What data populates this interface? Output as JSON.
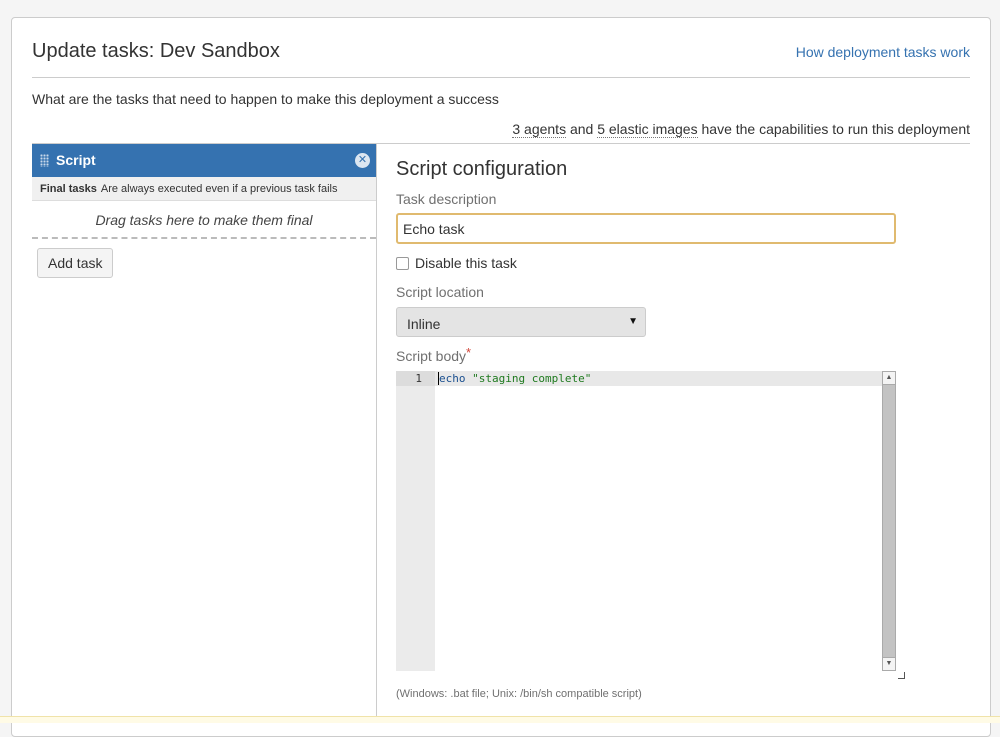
{
  "header": {
    "title": "Update tasks: Dev Sandbox",
    "help_link": "How deployment tasks work"
  },
  "intro": "What are the tasks that need to happen to make this deployment a success",
  "capabilities": {
    "agents": "3 agents",
    "conjunction": " and ",
    "images": "5 elastic images",
    "suffix": " have the capabilities to run this deployment"
  },
  "task_list": {
    "tasks": [
      {
        "name": "Script",
        "selected": true
      }
    ],
    "final_tasks": {
      "title": "Final tasks",
      "description": "Are always executed even if a previous task fails",
      "drop_hint": "Drag tasks here to make them final"
    },
    "add_task_label": "Add task"
  },
  "config": {
    "title": "Script configuration",
    "task_description_label": "Task description",
    "task_description_value": "Echo task",
    "disable_label": "Disable this task",
    "disable_checked": false,
    "script_location_label": "Script location",
    "script_location_value": "Inline",
    "script_body_label": "Script body",
    "required_marker": "*",
    "editor": {
      "line_number": "1",
      "code_keyword": "echo",
      "code_string": "\"staging complete\""
    },
    "hint": "(Windows: .bat file; Unix: /bin/sh compatible script)"
  },
  "icons": {
    "remove": "close-icon",
    "drag": "drag-handle-icon",
    "dropdown": "chevron-down-icon"
  },
  "colors": {
    "accent": "#3572b0",
    "focus_border": "#e0ba6f",
    "required": "#d04437"
  }
}
